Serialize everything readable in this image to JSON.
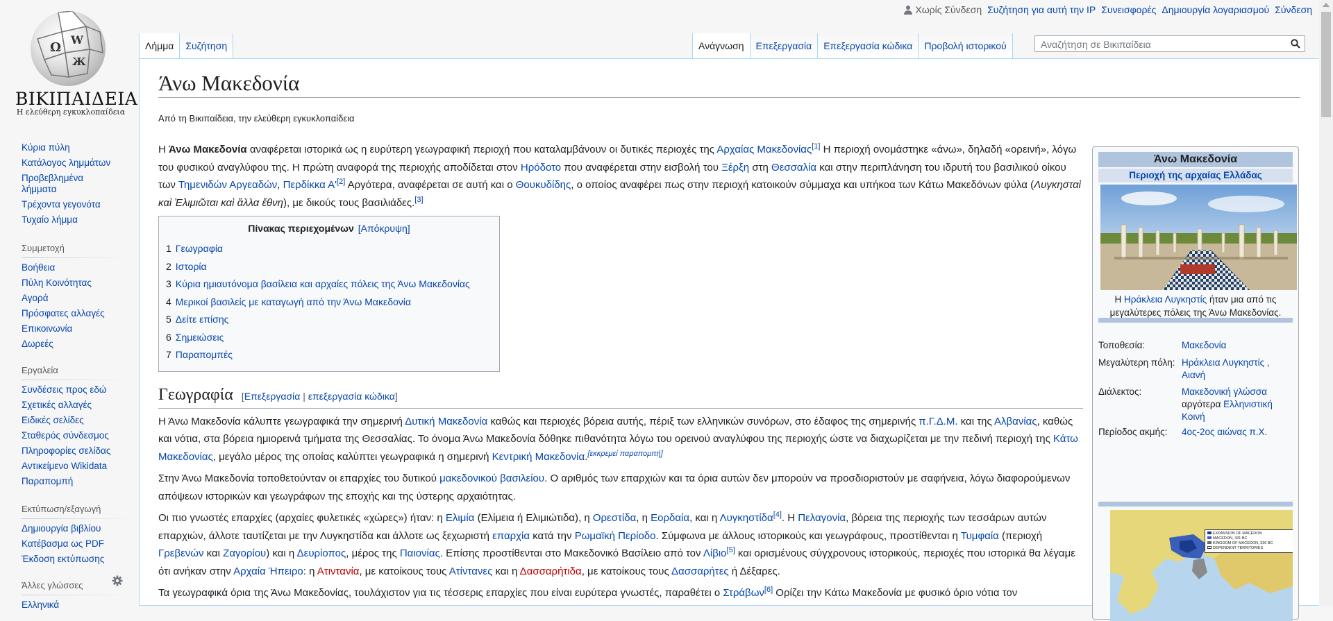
{
  "logo": {
    "wordmark": "ΒΙΚΙΠΑΙΔΕΙΑ",
    "tagline": "Η ελεύθερη εγκυκλοπαίδεια",
    "globe_glyphs": [
      "Ω",
      "W",
      "Ж"
    ]
  },
  "sidebar": {
    "navigation": [
      "Κύρια πύλη",
      "Κατάλογος λημμάτων",
      "Προβεβλημένα λήμματα",
      "Τρέχοντα γεγονότα",
      "Τυχαίο λήμμα"
    ],
    "participation": {
      "heading": "Συμμετοχή",
      "items": [
        "Βοήθεια",
        "Πύλη Κοινότητας",
        "Αγορά",
        "Πρόσφατες αλλαγές",
        "Επικοινωνία",
        "Δωρεές"
      ]
    },
    "tools": {
      "heading": "Εργαλεία",
      "items": [
        "Συνδέσεις προς εδώ",
        "Σχετικές αλλαγές",
        "Ειδικές σελίδες",
        "Σταθερός σύνδεσμος",
        "Πληροφορίες σελίδας",
        "Αντικείμενο Wikidata",
        "Παραπομπή"
      ]
    },
    "print": {
      "heading": "Εκτύπωση/εξαγωγή",
      "items": [
        "Δημιουργία βιβλίου",
        "Κατέβασμα ως PDF",
        "Έκδοση εκτύπωσης"
      ]
    },
    "languages": {
      "heading": "Άλλες γλώσσες",
      "first_item": "Ελληνικά"
    }
  },
  "personal": {
    "anon": "Χωρίς Σύνδεση",
    "talk": "Συζήτηση για αυτή την IP",
    "contribs": "Συνεισφορές",
    "create": "Δημιουργία λογαριασμού",
    "login": "Σύνδεση"
  },
  "tabs": {
    "left": [
      "Λήμμα",
      "Συζήτηση"
    ],
    "right": [
      "Ανάγνωση",
      "Επεξεργασία",
      "Επεξεργασία κώδικα",
      "Προβολή ιστορικού"
    ]
  },
  "search": {
    "placeholder": "Αναζήτηση σε Βικιπαίδεια"
  },
  "article": {
    "title": "Άνω Μακεδονία",
    "site_sub": "Από τη Βικιπαίδεια, την ελεύθερη εγκυκλοπαίδεια",
    "intro": {
      "t1": "Η ",
      "b1": "Άνω Μακεδονία",
      "t2": " αναφέρεται ιστορικά ως η ευρύτερη γεωγραφική περιοχή που καταλαμβάνουν οι δυτικές περιοχές της ",
      "l1": "Αρχαίας Μακεδονίας",
      "r1": "[1]",
      "t3": " Η περιοχή ονομάστηκε «άνω», δηλαδή «ορεινή», λόγω του φυσικού αναγλύφου της. Η πρώτη αναφορά της περιοχής αποδίδεται στον ",
      "l2": "Ηρόδοτο",
      "t4": " που αναφέρεται στην εισβολή του ",
      "l3": "Ξέρξη",
      "t5": " στη ",
      "l4": "Θεσσαλία",
      "t6": " και στην περιπλάνηση του ιδρυτή του βασιλικού οίκου των ",
      "l5": "Τημενιδών Αργεαδών",
      "t7": ", ",
      "l6": "Περδίκκα Α'",
      "r2": "[2]",
      "t8": " Αργότερα, αναφέρεται σε αυτή και ο ",
      "l7": "Θουκυδίδης",
      "t9": ", ο οποίος αναφέρει πως στην περιοχή κατοικούν σύμμαχα και υπήκοα των Κάτω Μακεδόνων φύλα (",
      "i1": "Λυγκησταὶ καὶ Ἐλιμιῶται καὶ ἄλλα ἔθνη",
      "t10": "), με δικούς τους βασιλιάδες.",
      "r3": "[3]"
    },
    "toc": {
      "title": "Πίνακας περιεχομένων",
      "toggle": "[Απόκρυψη]",
      "items": [
        {
          "num": "1",
          "label": "Γεωγραφία"
        },
        {
          "num": "2",
          "label": "Ιστορία"
        },
        {
          "num": "3",
          "label": "Κύρια ημιαυτόνομα βασίλεια και αρχαίες πόλεις της Άνω Μακεδονίας"
        },
        {
          "num": "4",
          "label": "Μερικοί βασιλείς με καταγωγή από την Άνω Μακεδονία"
        },
        {
          "num": "5",
          "label": "Δείτε επίσης"
        },
        {
          "num": "6",
          "label": "Σημειώσεις"
        },
        {
          "num": "7",
          "label": "Παραπομπές"
        }
      ]
    },
    "geo": {
      "heading": "Γεωγραφία",
      "edit_open": "[",
      "edit": "Επεξεργασία",
      "edit_sep": " | ",
      "edit_code": "επεξεργασία κώδικα",
      "edit_close": "]",
      "p1": {
        "t1": "Η Άνω Μακεδονία κάλυπτε γεωγραφικά την σημερινή ",
        "l1": "Δυτική Μακεδονία",
        "t2": " καθώς και περιοχές βόρεια αυτής, πέριξ των ελληνικών συνόρων, στο έδαφος της σημερινής ",
        "l2": "π.Γ.Δ.Μ.",
        "t3": " και της ",
        "l3": "Αλβανίας",
        "t4": ", καθώς και νότια, στα βόρεια ημιορεινά τμήματα της Θεσσαλίας. Το όνομα Άνω Μακεδονία δόθηκε πιθανότητα λόγω του ορεινού αναγλύφου της περιοχής ώστε να διαχωρίζεται με την πεδινή περιοχή της ",
        "l4": "Κάτω Μακεδονίας",
        "t5": ", μεγάλο μέρος της οποίας καλύπτει γεωγραφικά η σημερινή ",
        "l5": "Κεντρική Μακεδονία",
        "cn": "[εκκρεμεί παραπομπή]"
      },
      "p2": {
        "t1": "Στην Άνω Μακεδονία τοποθετούνταν οι επαρχίες του δυτικού ",
        "l1": "μακεδονικού βασιλείου",
        "t2": ". Ο αριθμός των επαρχιών και τα όρια αυτών δεν μπορούν να προσδιοριστούν με σαφήνεια, λόγω διαφορούμενων απόψεων ιστορικών και γεωγράφων της εποχής και της ύστερης αρχαιότητας."
      },
      "p3": {
        "t1": "Οι πιο γνωστές επαρχίες (αρχαίες φυλετικές «χώρες») ήταν: η ",
        "l1": "Ελιμία",
        "t2": " (Ελίμεια ή Ελιμιώτιδα), η ",
        "l2": "Ορεστίδα",
        "t3": ", η ",
        "l3": "Εορδαία",
        "t4": ", και η ",
        "l4": "Λυγκηστίδα",
        "r1": "[4]",
        "t5": ". Η ",
        "l5": "Πελαγονία",
        "t6": ", βόρεια της περιοχής των τεσσάρων αυτών επαρχιών, άλλοτε ταυτίζεται με την Λυγκηστίδα και άλλοτε ως ξεχωριστή ",
        "l6": "επαρχία",
        "t7": " κατά την ",
        "l7": "Ρωμαϊκή Περίοδο",
        "t8": ". Σύμφωνα με άλλους ιστορικούς και γεωγράφους, προστίθενται η ",
        "l8": "Τυμφαία",
        "t9": " (περιοχή ",
        "l9": "Γρεβενών",
        "t10": " και ",
        "l10": "Ζαγορίου",
        "t11": ") και η ",
        "l11": "Δευρίοπος",
        "t12": ", μέρος της ",
        "l12": "Παιονίας",
        "t13": ". Επίσης προστίθενται στο Μακεδονικό Βασίλειο από τον ",
        "l13": "Λίβιο",
        "r2": "[5]",
        "t14": " και ορισμένους σύγχρονους ιστορικούς, περιοχές που ιστορικά θα λέγαμε ότι ανήκαν στην ",
        "l14": "Αρχαία Ήπειρο",
        "t15": ": η ",
        "l15": "Ατιντανία",
        "t16": ", με κατοίκους τους ",
        "l16": "Ατίντανες",
        "t17": " και η ",
        "l17": "Δασσαρήτιδα",
        "t18": ", με κατοίκους τους ",
        "l18": "Δασσαρήτες",
        "t19": " ή Δέξαρες."
      },
      "p4": {
        "t1": "Τα γεωγραφικά όρια της Άνω Μακεδονίας, τουλάχιστον για τις τέσσερις επαρχίες που είναι ευρύτερα γνωστές, παραθέτει ο ",
        "l1": "Στράβων",
        "r1": "[6]",
        "t2": " Ορίζει την Κάτω Μακεδονία με φυσικό όριο νότια τον"
      }
    }
  },
  "infobox": {
    "title": "Άνω Μακεδονία",
    "subtitle": "Περιοχή της αρχαίας Ελλάδας",
    "caption": {
      "t1": "Η ",
      "l1": "Ηράκλεια Λυγκηστίς",
      "t2": " ήταν μια από τις μεγαλύτερες πόλεις της Άνω Μακεδονίας."
    },
    "rows": [
      {
        "label": "Τοποθεσία:",
        "value": "Μακεδονία"
      },
      {
        "label": "Μεγαλύτερη πόλη:",
        "value": "Ηράκλεια Λυγκηστίς , Αιανή"
      },
      {
        "label": "Διάλεκτος:",
        "value_l1": "Μακεδονική γλώσσα",
        "value_t": " αργότερα ",
        "value_l2": "Ελληνιστική Κοινή"
      },
      {
        "label": "Περίοδος ακμής:",
        "value": "4ος-2ος αιώνας π.Χ."
      }
    ],
    "map_legend": [
      "EXPANSION OF MACEDON",
      "MACEDON, 431 BC",
      "KINGDOM OF MACEDON, 336 BC",
      "DEPENDENT TERRITORIES"
    ],
    "map_legend_colors": [
      "#1a3a8c",
      "#3a5fb8",
      "#6a6a6a",
      "#ffffff"
    ]
  }
}
